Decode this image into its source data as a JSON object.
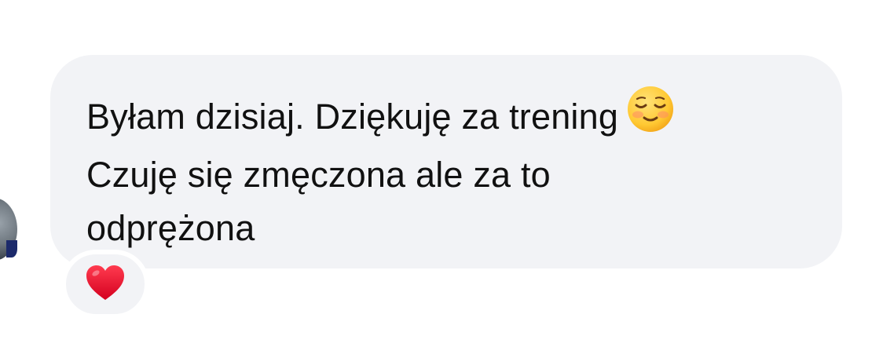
{
  "message": {
    "lines": [
      "Byłam dzisiaj. Dziękuję za trening",
      "Czuję się zmęczona ale za to",
      "odprężona"
    ],
    "emoji": "smiling-face-with-closed-eyes"
  },
  "reaction": {
    "emoji": "red-heart",
    "color": "#e0102e"
  },
  "colors": {
    "bubble": "#f2f3f6",
    "text": "#111111",
    "background": "#ffffff"
  }
}
